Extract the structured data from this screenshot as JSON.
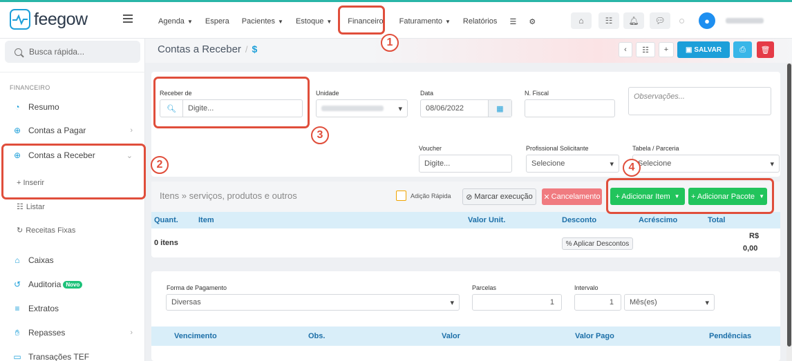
{
  "brand": {
    "name": "feegow",
    "accent": "#1c9fd9"
  },
  "nav": {
    "items": [
      {
        "label": "Agenda",
        "caret": true
      },
      {
        "label": "Espera",
        "caret": false
      },
      {
        "label": "Pacientes",
        "caret": true
      },
      {
        "label": "Estoque",
        "caret": true
      },
      {
        "label": "Financeiro",
        "caret": false
      },
      {
        "label": "Faturamento",
        "caret": true
      },
      {
        "label": "Relatórios",
        "caret": false
      }
    ]
  },
  "search": {
    "placeholder": "Busca rápida..."
  },
  "sidebar": {
    "section": "FINANCEIRO",
    "items": [
      {
        "label": "Resumo",
        "icon": "chart-pie-icon"
      },
      {
        "label": "Contas a Pagar",
        "icon": "arrow-up-circle-icon"
      },
      {
        "label": "Contas a Receber",
        "icon": "arrow-down-circle-icon"
      },
      {
        "label": "Caixas",
        "icon": "inbox-icon"
      },
      {
        "label": "Auditoria",
        "icon": "history-icon",
        "badge": "Novo"
      },
      {
        "label": "Extratos",
        "icon": "list-icon"
      },
      {
        "label": "Repasses",
        "icon": "hand-coins-icon"
      },
      {
        "label": "Transações TEF",
        "icon": "card-icon"
      }
    ],
    "sub": {
      "inserir": "+ Inserir",
      "listar": "Listar",
      "receitas": "Receitas Fixas"
    }
  },
  "page": {
    "title": "Contas a Receber",
    "save_label": "SALVAR"
  },
  "form": {
    "receber_de": {
      "label": "Receber de",
      "placeholder": "Digite..."
    },
    "unidade": {
      "label": "Unidade"
    },
    "data": {
      "label": "Data",
      "value": "08/06/2022"
    },
    "nfiscal": {
      "label": "N. Fiscal"
    },
    "obs": {
      "placeholder": "Observações..."
    },
    "voucher": {
      "label": "Voucher",
      "placeholder": "Digite..."
    },
    "profissional": {
      "label": "Profissional Solicitante",
      "value": "Selecione"
    },
    "tabela": {
      "label": "Tabela / Parceria",
      "value": "Selecione"
    }
  },
  "items": {
    "title": "Itens » serviços, produtos e outros",
    "adicao_rapida": "Adição Rápida",
    "marcar": "Marcar execução",
    "cancelamento": "Cancelamento",
    "add_item": "+ Adicionar Item",
    "add_pacote": "+ Adicionar Pacote",
    "columns": [
      "Quant.",
      "Item",
      "Valor Unit.",
      "Desconto",
      "Acréscimo",
      "Total"
    ],
    "count": "0 itens",
    "aplicar": "Aplicar Descontos",
    "total_currency": "R$",
    "total_value": "0,00"
  },
  "payment": {
    "forma_label": "Forma de Pagamento",
    "forma_value": "Diversas",
    "parcelas_label": "Parcelas",
    "parcelas_value": "1",
    "intervalo_label": "Intervalo",
    "intervalo_value": "1",
    "intervalo_unit": "Mês(es)",
    "columns": [
      "Vencimento",
      "Obs.",
      "Valor",
      "Valor Pago",
      "Pendências"
    ]
  },
  "callouts": [
    "1",
    "2",
    "3",
    "4"
  ]
}
